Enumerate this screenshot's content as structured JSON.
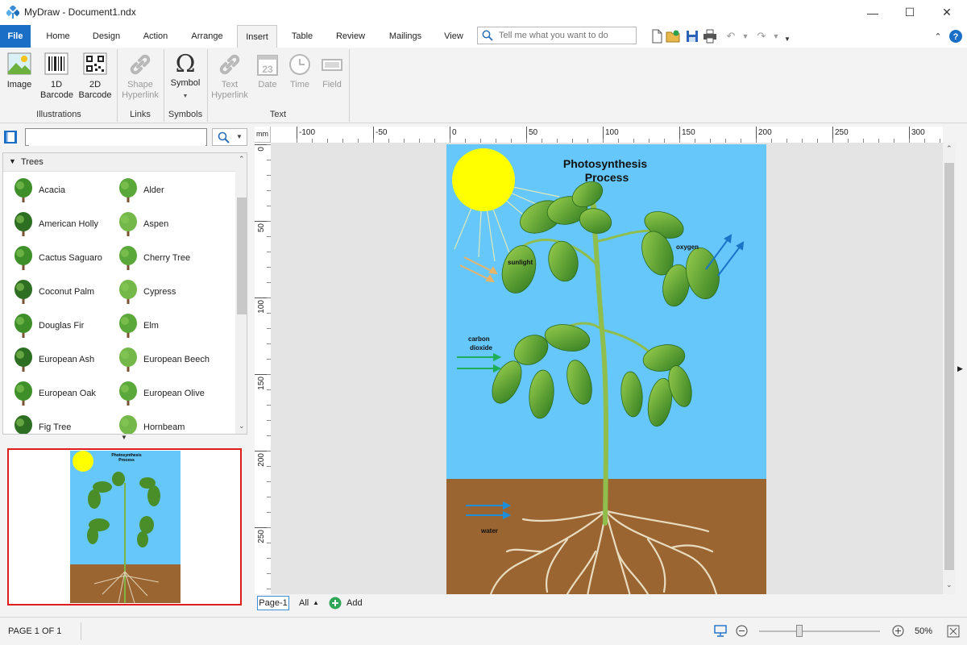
{
  "window": {
    "title": "MyDraw - Document1.ndx"
  },
  "ribbon_tabs": [
    {
      "label": "File"
    },
    {
      "label": "Home"
    },
    {
      "label": "Design"
    },
    {
      "label": "Action"
    },
    {
      "label": "Arrange"
    },
    {
      "label": "Insert"
    },
    {
      "label": "Table"
    },
    {
      "label": "Review"
    },
    {
      "label": "Mailings"
    },
    {
      "label": "View"
    }
  ],
  "active_tab": "Insert",
  "tell_me": {
    "placeholder": "Tell me what you want to do"
  },
  "ribbon": {
    "illustrations": {
      "label": "Illustrations",
      "image": "Image",
      "barcode1d": "1D\nBarcode",
      "barcode2d": "2D\nBarcode"
    },
    "links": {
      "label": "Links",
      "shape_hyperlink": "Shape\nHyperlink"
    },
    "symbols": {
      "label": "Symbols",
      "symbol": "Symbol"
    },
    "text": {
      "label": "Text",
      "text_hyperlink": "Text\nHyperlink",
      "date": "Date",
      "time": "Time",
      "field": "Field"
    }
  },
  "library": {
    "search_value": "",
    "category": "Trees",
    "items": [
      "Acacia",
      "Alder",
      "American Holly",
      "Aspen",
      "Cactus Saguaro",
      "Cherry Tree",
      "Coconut Palm",
      "Cypress",
      "Douglas Fir",
      "Elm",
      "European Ash",
      "European Beech",
      "European Oak",
      "European Olive",
      "Fig Tree",
      "Hornbeam"
    ]
  },
  "ruler": {
    "unit": "mm",
    "top_ticks": [
      "-100",
      "-50",
      "0",
      "50",
      "100",
      "150",
      "200",
      "250",
      "300"
    ],
    "left_ticks": [
      "0",
      "50",
      "100",
      "150",
      "200",
      "250"
    ]
  },
  "drawing": {
    "title_line1": "Photosynthesis",
    "title_line2": "Process",
    "label_sunlight": "sunlight",
    "label_oxygen": "oxygen",
    "label_carbon1": "carbon",
    "label_carbon2": "dioxide",
    "label_water": "water"
  },
  "thumbnail": {
    "title_line1": "Photosynthesis",
    "title_line2": "Process"
  },
  "page_tabs": {
    "current": "Page-1",
    "all": "All",
    "add": "Add"
  },
  "status": {
    "page_info": "PAGE 1 OF 1",
    "zoom": "50%",
    "zoom_level": 0.33
  },
  "colors": {
    "sky": "#66c7fb",
    "soil": "#9b6532",
    "sun": "#ffff00",
    "file_tab": "#1a6ec6",
    "thumb_border": "#e21b1b"
  }
}
